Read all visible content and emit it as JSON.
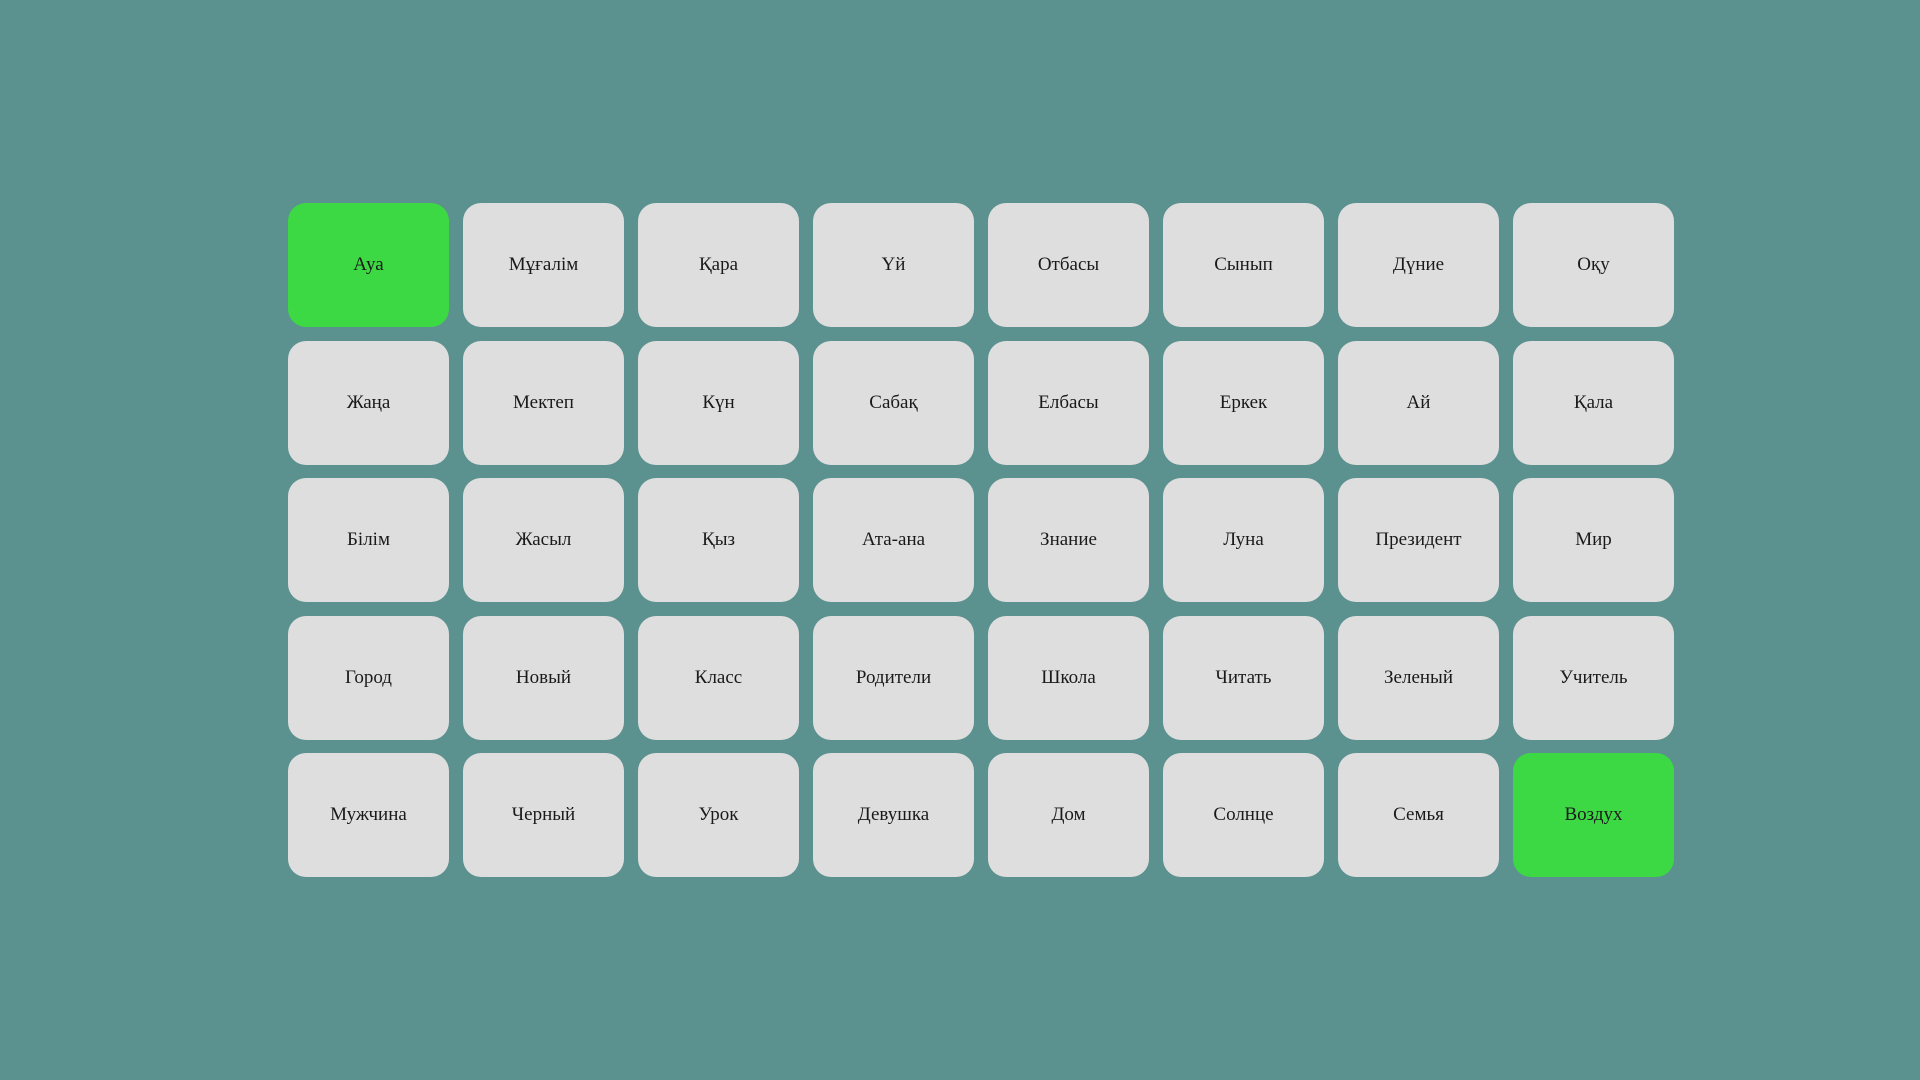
{
  "colors": {
    "background": "#5b918f",
    "tile": "#dedede",
    "tile_matched": "#3dd944",
    "text": "#1a1a1a"
  },
  "board": {
    "columns": 8,
    "tiles": [
      {
        "word": "Ауа",
        "state": "matched"
      },
      {
        "word": "Мұғалім",
        "state": "default"
      },
      {
        "word": "Қара",
        "state": "default"
      },
      {
        "word": "Үй",
        "state": "default"
      },
      {
        "word": "Отбасы",
        "state": "default"
      },
      {
        "word": "Сынып",
        "state": "default"
      },
      {
        "word": "Дүние",
        "state": "default"
      },
      {
        "word": "Оқу",
        "state": "default"
      },
      {
        "word": "Жаңа",
        "state": "default"
      },
      {
        "word": "Мектеп",
        "state": "default"
      },
      {
        "word": "Күн",
        "state": "default"
      },
      {
        "word": "Сабақ",
        "state": "default"
      },
      {
        "word": "Елбасы",
        "state": "default"
      },
      {
        "word": "Еркек",
        "state": "default"
      },
      {
        "word": "Ай",
        "state": "default"
      },
      {
        "word": "Қала",
        "state": "default"
      },
      {
        "word": "Білім",
        "state": "default"
      },
      {
        "word": "Жасыл",
        "state": "default"
      },
      {
        "word": "Қыз",
        "state": "default"
      },
      {
        "word": "Ата-ана",
        "state": "default"
      },
      {
        "word": "Знание",
        "state": "default"
      },
      {
        "word": "Луна",
        "state": "default"
      },
      {
        "word": "Президент",
        "state": "default"
      },
      {
        "word": "Мир",
        "state": "default"
      },
      {
        "word": "Город",
        "state": "default"
      },
      {
        "word": "Новый",
        "state": "default"
      },
      {
        "word": "Класс",
        "state": "default"
      },
      {
        "word": "Родители",
        "state": "default"
      },
      {
        "word": "Школа",
        "state": "default"
      },
      {
        "word": "Читать",
        "state": "default"
      },
      {
        "word": "Зеленый",
        "state": "default"
      },
      {
        "word": "Учитель",
        "state": "default"
      },
      {
        "word": "Мужчина",
        "state": "default"
      },
      {
        "word": "Черный",
        "state": "default"
      },
      {
        "word": "Урок",
        "state": "default"
      },
      {
        "word": "Девушка",
        "state": "default"
      },
      {
        "word": "Дом",
        "state": "default"
      },
      {
        "word": "Солнце",
        "state": "default"
      },
      {
        "word": "Семья",
        "state": "default"
      },
      {
        "word": "Воздух",
        "state": "matched"
      }
    ]
  }
}
